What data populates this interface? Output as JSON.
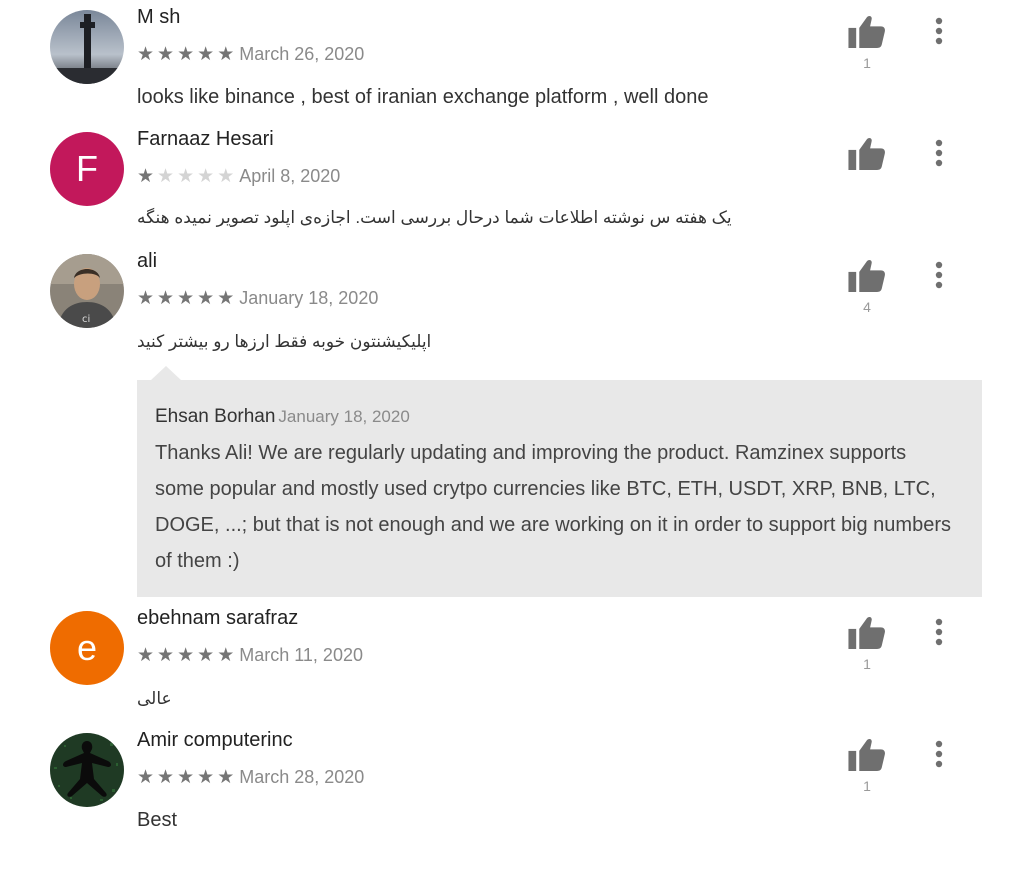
{
  "colors": {
    "star_on": "#757575",
    "star_off": "#d4d4d4",
    "avatar_f": "#c2185b",
    "avatar_e": "#ef6c00",
    "reply_bg": "#e8e8e8"
  },
  "reviews": [
    {
      "name": "M sh",
      "avatar": "photo-tower",
      "rating": 5,
      "stars": [
        "★",
        "★",
        "★",
        "★",
        "★"
      ],
      "date": "March 26, 2020",
      "text": "looks like binance , best of iranian exchange platform , well done",
      "likes": "1"
    },
    {
      "name": "Farnaaz Hesari",
      "avatar_letter": "F",
      "rating": 1,
      "stars": [
        "★",
        "★",
        "★",
        "★",
        "★"
      ],
      "date": "April 8, 2020",
      "text": "یک هفته س نوشته اطلاعات شما درحال بررسی است. اجازه‌ی اپلود تصویر نمیده هنگه",
      "likes": ""
    },
    {
      "name": "ali",
      "avatar": "photo-person",
      "rating": 5,
      "stars": [
        "★",
        "★",
        "★",
        "★",
        "★"
      ],
      "date": "January 18, 2020",
      "text": "اپلیکیشنتون خوبه فقط ارزها رو بیشتر کنید",
      "likes": "4",
      "reply": {
        "author": "Ehsan Borhan",
        "date": "January 18, 2020",
        "text": "Thanks Ali! We are regularly updating and improving the product. Ramzinex supports some popular and mostly used crytpo currencies like BTC, ETH, USDT, XRP, BNB, LTC, DOGE, ...; but that is not enough and we are working on it in order to support big numbers of them :)"
      }
    },
    {
      "name": "ebehnam sarafraz",
      "avatar_letter": "e",
      "rating": 5,
      "stars": [
        "★",
        "★",
        "★",
        "★",
        "★"
      ],
      "date": "March 11, 2020",
      "text": "عالی",
      "likes": "1"
    },
    {
      "name": "Amir computerinc",
      "avatar": "photo-figure",
      "rating": 5,
      "stars": [
        "★",
        "★",
        "★",
        "★",
        "★"
      ],
      "date": "March 28, 2020",
      "text": "Best",
      "likes": "1"
    }
  ],
  "icons": {
    "like": "thumbs-up-icon",
    "more": "more-vert-icon"
  }
}
